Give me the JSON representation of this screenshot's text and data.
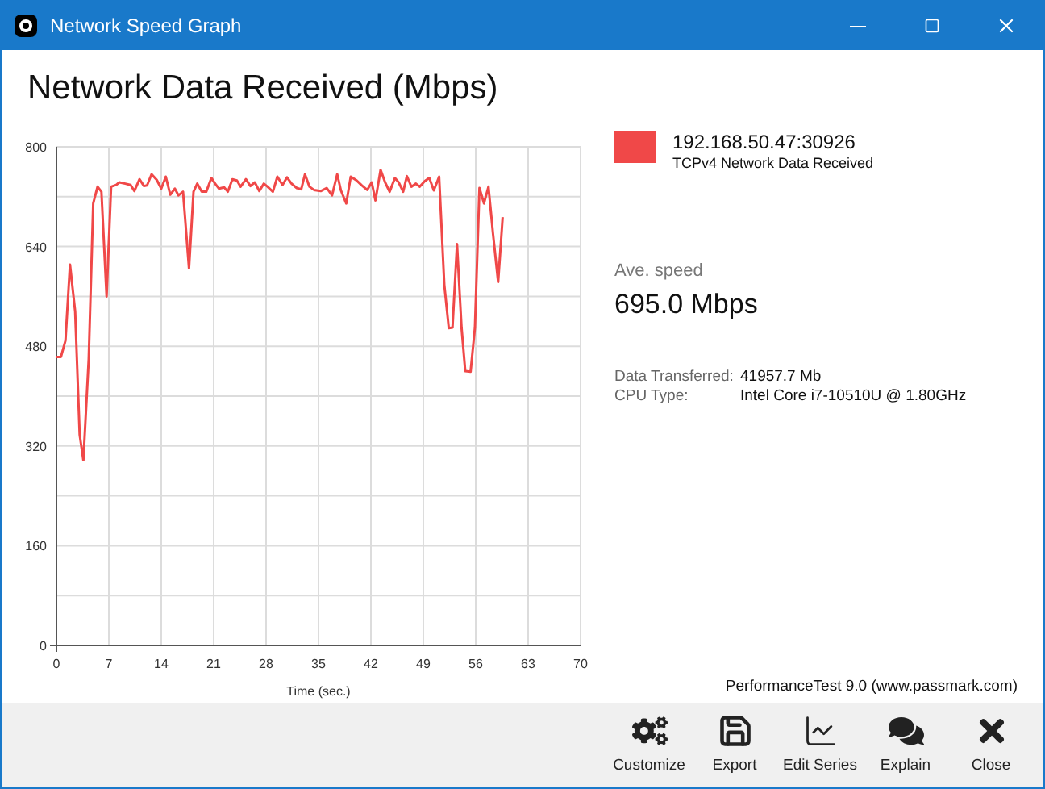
{
  "window": {
    "title": "Network Speed Graph"
  },
  "graph": {
    "title": "Network Data Received (Mbps)",
    "chart_data": {
      "type": "line",
      "grid": true,
      "xlabel": "Time (sec.)",
      "ylim": [
        0,
        800
      ],
      "xlim": [
        0,
        70
      ],
      "xticks": [
        0,
        7,
        14,
        21,
        28,
        35,
        42,
        49,
        56,
        63,
        70
      ],
      "yticks": [
        0,
        160,
        320,
        480,
        640,
        800
      ],
      "x": [
        0,
        0.6,
        1.2,
        1.8,
        2.5,
        3.1,
        3.6,
        4.3,
        4.9,
        5.5,
        6,
        6.7,
        7.3,
        8,
        8.4,
        9.2,
        9.9,
        10.4,
        11.1,
        11.7,
        12.1,
        12.7,
        13.4,
        14,
        14.6,
        15.2,
        15.8,
        16.3,
        16.9,
        17.7,
        18.3,
        18.8,
        19.4,
        20,
        20.7,
        21.2,
        21.7,
        22.4,
        22.9,
        23.5,
        24.1,
        24.6,
        25.3,
        25.9,
        26.5,
        27.1,
        27.7,
        28.2,
        28.9,
        29.5,
        30.2,
        30.8,
        31.4,
        32.1,
        32.7,
        33.2,
        33.8,
        34.4,
        35.3,
        36.1,
        36.8,
        37.5,
        38,
        38.7,
        39.3,
        40.1,
        40.8,
        41.5,
        42.1,
        42.6,
        43.3,
        43.9,
        44.5,
        45.2,
        45.7,
        46.3,
        46.8,
        47.4,
        48,
        48.5,
        49.2,
        49.8,
        50.4,
        51.1,
        51.8,
        52.4,
        52.9,
        53.5,
        54.1,
        54.6,
        55.3,
        55.9,
        56.5,
        57.1,
        57.7,
        58.3,
        59,
        59.6
      ],
      "series": [
        {
          "name": "192.168.50.47:30926",
          "color": "#f04848",
          "values": [
            463,
            463,
            489,
            611,
            536,
            338,
            297,
            459,
            709,
            736,
            728,
            560,
            736,
            739,
            743,
            741,
            739,
            729,
            748,
            737,
            738,
            756,
            747,
            733,
            752,
            723,
            733,
            722,
            728,
            605,
            728,
            741,
            728,
            728,
            750,
            741,
            733,
            735,
            728,
            748,
            746,
            736,
            748,
            737,
            743,
            729,
            741,
            736,
            728,
            752,
            739,
            751,
            741,
            734,
            732,
            756,
            736,
            731,
            729,
            734,
            722,
            756,
            730,
            709,
            752,
            746,
            738,
            731,
            743,
            714,
            763,
            743,
            728,
            750,
            743,
            728,
            753,
            736,
            741,
            736,
            745,
            750,
            730,
            752,
            579,
            509,
            510,
            644,
            510,
            440,
            439,
            510,
            734,
            709,
            736,
            661,
            583,
            687
          ]
        }
      ]
    }
  },
  "legend": {
    "description": "TCPv4 Network Data Received"
  },
  "average": {
    "label": "Ave. speed",
    "value": "695.0 Mbps"
  },
  "details": [
    {
      "label": "Data Transferred:",
      "value": "41957.7 Mb"
    },
    {
      "label": "CPU Type:",
      "value": "Intel Core i7-10510U @ 1.80GHz"
    }
  ],
  "credit": "PerformanceTest 9.0 (www.passmark.com)",
  "toolbar": [
    {
      "kind": "customize",
      "label": "Customize"
    },
    {
      "kind": "export",
      "label": "Export"
    },
    {
      "kind": "edit",
      "label": "Edit Series"
    },
    {
      "kind": "explain",
      "label": "Explain"
    },
    {
      "kind": "close",
      "label": "Close"
    }
  ]
}
